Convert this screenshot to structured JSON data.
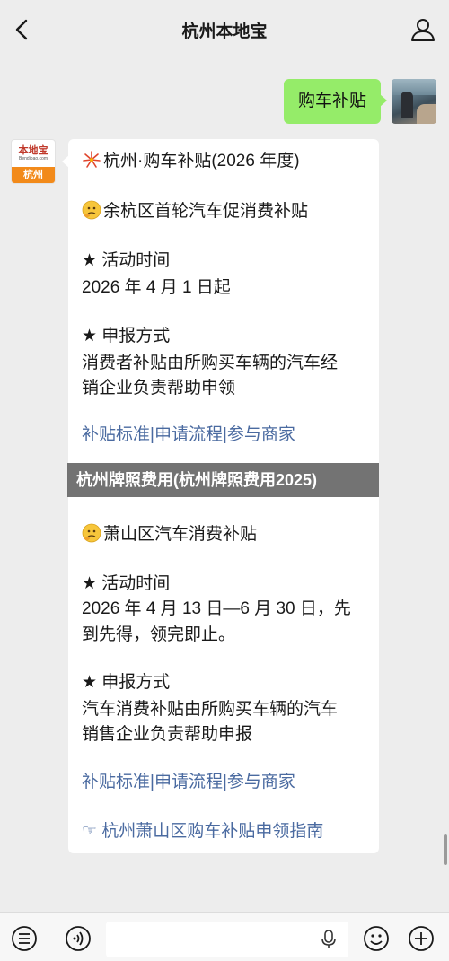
{
  "header": {
    "title": "杭州本地宝"
  },
  "outgoing": {
    "text": "购车补贴"
  },
  "bot_avatar": {
    "logo_top": "本地宝",
    "logo_sub": "Bendibao.com",
    "logo_city": "杭州"
  },
  "message": {
    "title": "杭州·购车补贴(2026 年度)",
    "section1": {
      "name": "余杭区首轮汽车促消费补贴",
      "activity_label": "★ 活动时间",
      "activity_value": "2026 年 4 月 1 日起",
      "apply_label": "★ 申报方式",
      "apply_line1": "消费者补贴由所购买车辆的汽车经",
      "apply_line2": "销企业负责帮助申领",
      "links": [
        "补贴标准",
        "申请流程",
        "参与商家"
      ]
    },
    "section2": {
      "name": "萧山区汽车消费补贴",
      "activity_label": "★ 活动时间",
      "activity_line1": "2026 年 4 月 13 日—6 月 30 日，先",
      "activity_line2": "到先得，领完即止。",
      "apply_label": "★ 申报方式",
      "apply_line1": "汽车消费补贴由所购买车辆的汽车",
      "apply_line2": "销售企业负责帮助申报",
      "links": [
        "补贴标准",
        "申请流程",
        "参与商家"
      ],
      "guide": "☞ 杭州萧山区购车补贴申领指南"
    },
    "link_separator": "|"
  },
  "overlay": {
    "banner": "杭州牌照费用(杭州牌照费用2025)"
  },
  "colors": {
    "background": "#ededed",
    "outgoing_bubble": "#95ec69",
    "link": "#4a6aa0",
    "logo_orange": "#f28a1a"
  }
}
